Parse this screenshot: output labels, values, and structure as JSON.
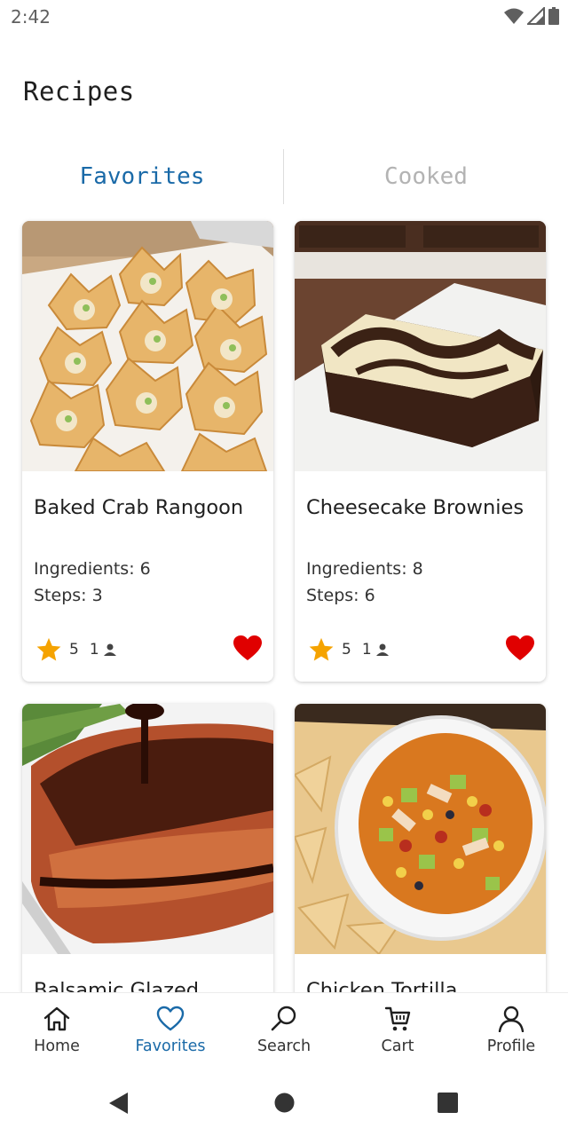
{
  "status": {
    "time": "2:42"
  },
  "header": {
    "title": "Recipes"
  },
  "tabs": [
    {
      "label": "Favorites",
      "active": true
    },
    {
      "label": "Cooked",
      "active": false
    }
  ],
  "recipes": [
    {
      "title": "Baked Crab Rangoon",
      "ingredients": "Ingredients: 6",
      "steps": "Steps: 3",
      "rating": "5",
      "cooks": "1",
      "favorite": true,
      "image": "crab-rangoon-photo"
    },
    {
      "title": "Cheesecake Brownies",
      "ingredients": "Ingredients: 8",
      "steps": "Steps: 6",
      "rating": "5",
      "cooks": "1",
      "favorite": true,
      "image": "cheesecake-brownie-photo"
    },
    {
      "title": "Balsamic Glazed",
      "image": "balsamic-salmon-photo"
    },
    {
      "title": "Chicken Tortilla",
      "image": "chicken-tortilla-soup-photo"
    }
  ],
  "bottom_nav": [
    {
      "label": "Home",
      "icon": "home-icon",
      "active": false
    },
    {
      "label": "Favorites",
      "icon": "heart-outline-icon",
      "active": true
    },
    {
      "label": "Search",
      "icon": "search-icon",
      "active": false
    },
    {
      "label": "Cart",
      "icon": "cart-icon",
      "active": false
    },
    {
      "label": "Profile",
      "icon": "person-icon",
      "active": false
    }
  ],
  "colors": {
    "accent": "#1a6aa8",
    "star": "#f5a300",
    "heart": "#e00000",
    "inactive_tab": "#b3b3b3"
  }
}
